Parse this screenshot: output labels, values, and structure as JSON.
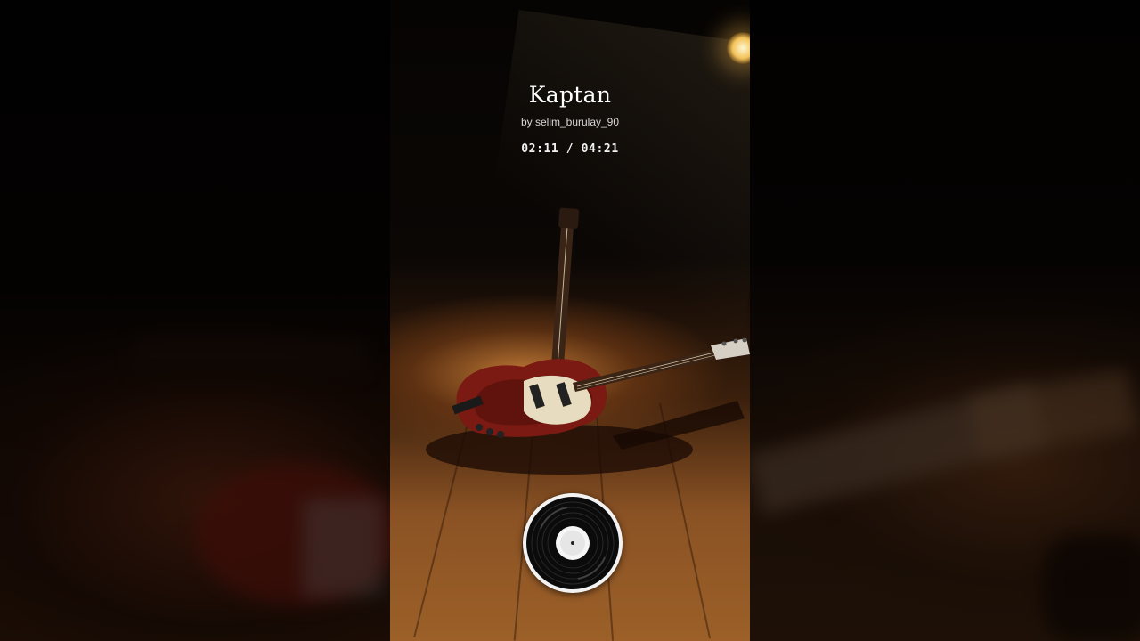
{
  "track": {
    "title": "Kaptan",
    "artist": "by selim_burulay_90",
    "time": "02:11 / 04:21"
  },
  "background": {
    "scene": "electric-guitar-on-wooden-stage",
    "icons": [
      "vinyl-record-icon",
      "spotlight-icon",
      "guitar-illustration"
    ]
  },
  "colors": {
    "text": "#ffffff",
    "floor": "#9c6028",
    "guitar_body": "#7a1a12"
  }
}
